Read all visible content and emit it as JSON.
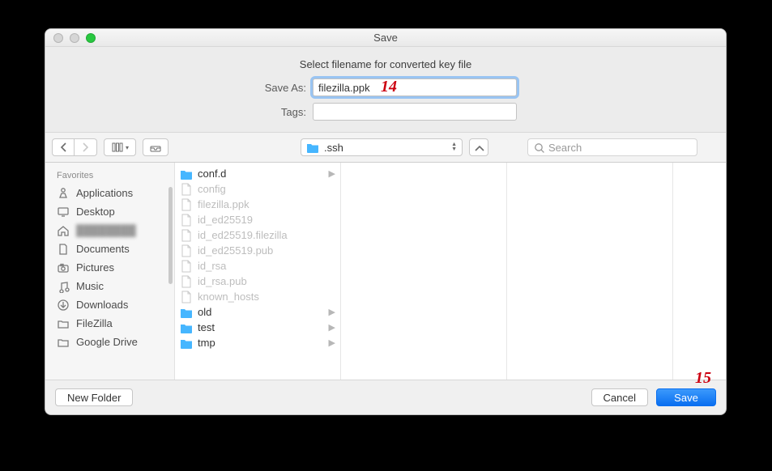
{
  "window": {
    "title": "Save",
    "subtitle": "Select filename for converted key file"
  },
  "form": {
    "save_as_label": "Save As:",
    "filename": "filezilla.ppk",
    "tags_label": "Tags:",
    "tags_value": ""
  },
  "toolbar": {
    "path_folder": ".ssh",
    "search_placeholder": "Search"
  },
  "sidebar": {
    "header": "Favorites",
    "items": [
      {
        "icon": "apps",
        "label": "Applications"
      },
      {
        "icon": "desktop",
        "label": "Desktop"
      },
      {
        "icon": "house",
        "label": ""
      },
      {
        "icon": "doc",
        "label": "Documents"
      },
      {
        "icon": "camera",
        "label": "Pictures"
      },
      {
        "icon": "music",
        "label": "Music"
      },
      {
        "icon": "download",
        "label": "Downloads"
      },
      {
        "icon": "folder",
        "label": "FileZilla"
      },
      {
        "icon": "folder",
        "label": "Google Drive"
      }
    ]
  },
  "column": {
    "items": [
      {
        "type": "folder",
        "label": "conf.d",
        "dim": false,
        "arrow": true
      },
      {
        "type": "file",
        "label": "config",
        "dim": true
      },
      {
        "type": "file",
        "label": "filezilla.ppk",
        "dim": true
      },
      {
        "type": "file",
        "label": "id_ed25519",
        "dim": true
      },
      {
        "type": "file",
        "label": "id_ed25519.filezilla",
        "dim": true
      },
      {
        "type": "file",
        "label": "id_ed25519.pub",
        "dim": true
      },
      {
        "type": "file",
        "label": "id_rsa",
        "dim": true
      },
      {
        "type": "file",
        "label": "id_rsa.pub",
        "dim": true
      },
      {
        "type": "file",
        "label": "known_hosts",
        "dim": true
      },
      {
        "type": "folder",
        "label": "old",
        "dim": false,
        "arrow": true
      },
      {
        "type": "folder",
        "label": "test",
        "dim": false,
        "arrow": true
      },
      {
        "type": "folder",
        "label": "tmp",
        "dim": false,
        "arrow": true
      }
    ]
  },
  "footer": {
    "new_folder": "New Folder",
    "cancel": "Cancel",
    "save": "Save"
  },
  "annotations": {
    "a14": "14",
    "a15": "15"
  }
}
